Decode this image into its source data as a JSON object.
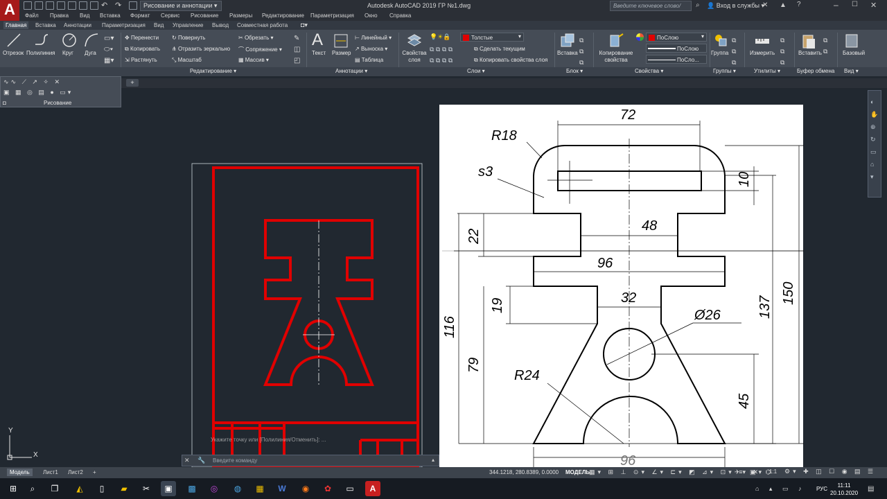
{
  "app": {
    "title": "Autodesk AutoCAD 2019   ГР №1.dwg",
    "workspace": "Рисование и аннотации",
    "search_placeholder": "Введите ключевое слово/фразу",
    "sign_in": "Вход в службы"
  },
  "menus": [
    "Файл",
    "Правка",
    "Вид",
    "Вставка",
    "Формат",
    "Сервис",
    "Рисование",
    "Размеры",
    "Редактирование",
    "Параметризация",
    "Окно",
    "Справка"
  ],
  "tabs": [
    "Главная",
    "Вставка",
    "Аннотации",
    "Параметризация",
    "Вид",
    "Управление",
    "Вывод",
    "Совместная работа"
  ],
  "ribbon": {
    "draw": {
      "line": "Отрезок",
      "polyline": "Полилиния",
      "circle": "Круг",
      "arc": "Дуга"
    },
    "modify": {
      "move": "Перенести",
      "rotate": "Повернуть",
      "trim": "Обрезать",
      "copy": "Копировать",
      "mirror": "Отразить зеркально",
      "fillet": "Сопряжение",
      "stretch": "Растянуть",
      "scale": "Масштаб",
      "array": "Массив"
    },
    "annotation": {
      "text": "Текст",
      "dimension": "Размер",
      "linear": "Линейный",
      "leader": "Выноска",
      "table": "Таблица"
    },
    "layers": {
      "props": "Свойства слоя",
      "current_layer": "Толстые",
      "make_current": "Сделать текущим",
      "match_layer": "Копировать свойства слоя"
    },
    "block": {
      "insert": "Вставка"
    },
    "properties": {
      "match": "Копирование свойства",
      "color": "ПоСлою",
      "linetype": "ПоСлою",
      "lineweight": "ПоСло..."
    },
    "groups": {
      "group": "Группа"
    },
    "utilities": {
      "measure": "Измерить"
    },
    "clipboard": {
      "paste": "Вставить"
    },
    "view": {
      "base": "Базовый"
    },
    "panels": {
      "modify": "Редактирование",
      "annotation": "Аннотации",
      "layers": "Слои",
      "block": "Блок",
      "properties": "Свойства",
      "groups": "Группы",
      "utilities": "Утилиты",
      "clipboard": "Буфер обмена",
      "view": "Вид",
      "draw": "Рисование"
    },
    "colors": {
      "layer_red": "#e00000",
      "accent_blue": "#4a90d9"
    }
  },
  "layout_tabs": {
    "model": "Модель",
    "sheet1": "Лист1",
    "sheet2": "Лист2"
  },
  "status": {
    "coords": "344.1218, 280.8389, 0.0000",
    "mode": "МОДЕЛЬ",
    "scale": "1:1"
  },
  "command": {
    "placeholder": "Введите команду",
    "history": "Укажите точку или [Полилиния/Отменить]: ...",
    "history2": "Лит  Масса  Масштаб"
  },
  "ucs": {
    "x": "X",
    "y": "Y"
  },
  "taskbar": {
    "lang": "РУС",
    "time": "11:11",
    "date": "20.10.2020"
  },
  "drawing": {
    "r18": "R18",
    "s3": "s3",
    "d72": "72",
    "d10": "10",
    "d22": "22",
    "d48": "48",
    "d96": "96",
    "d19": "19",
    "d32": "32",
    "d116": "116",
    "d137": "137",
    "d150": "150",
    "phi26": "Ø26",
    "d79": "79",
    "d45": "45",
    "r24": "R24",
    "d96b": "96"
  },
  "sheet_labels": {
    "lit": "Лит",
    "massa": "Масса",
    "masshtab": "Масштаб",
    "izm": "Изм.",
    "list": "Лист",
    "razrab": "Разраб.",
    "prov": "Пров."
  }
}
